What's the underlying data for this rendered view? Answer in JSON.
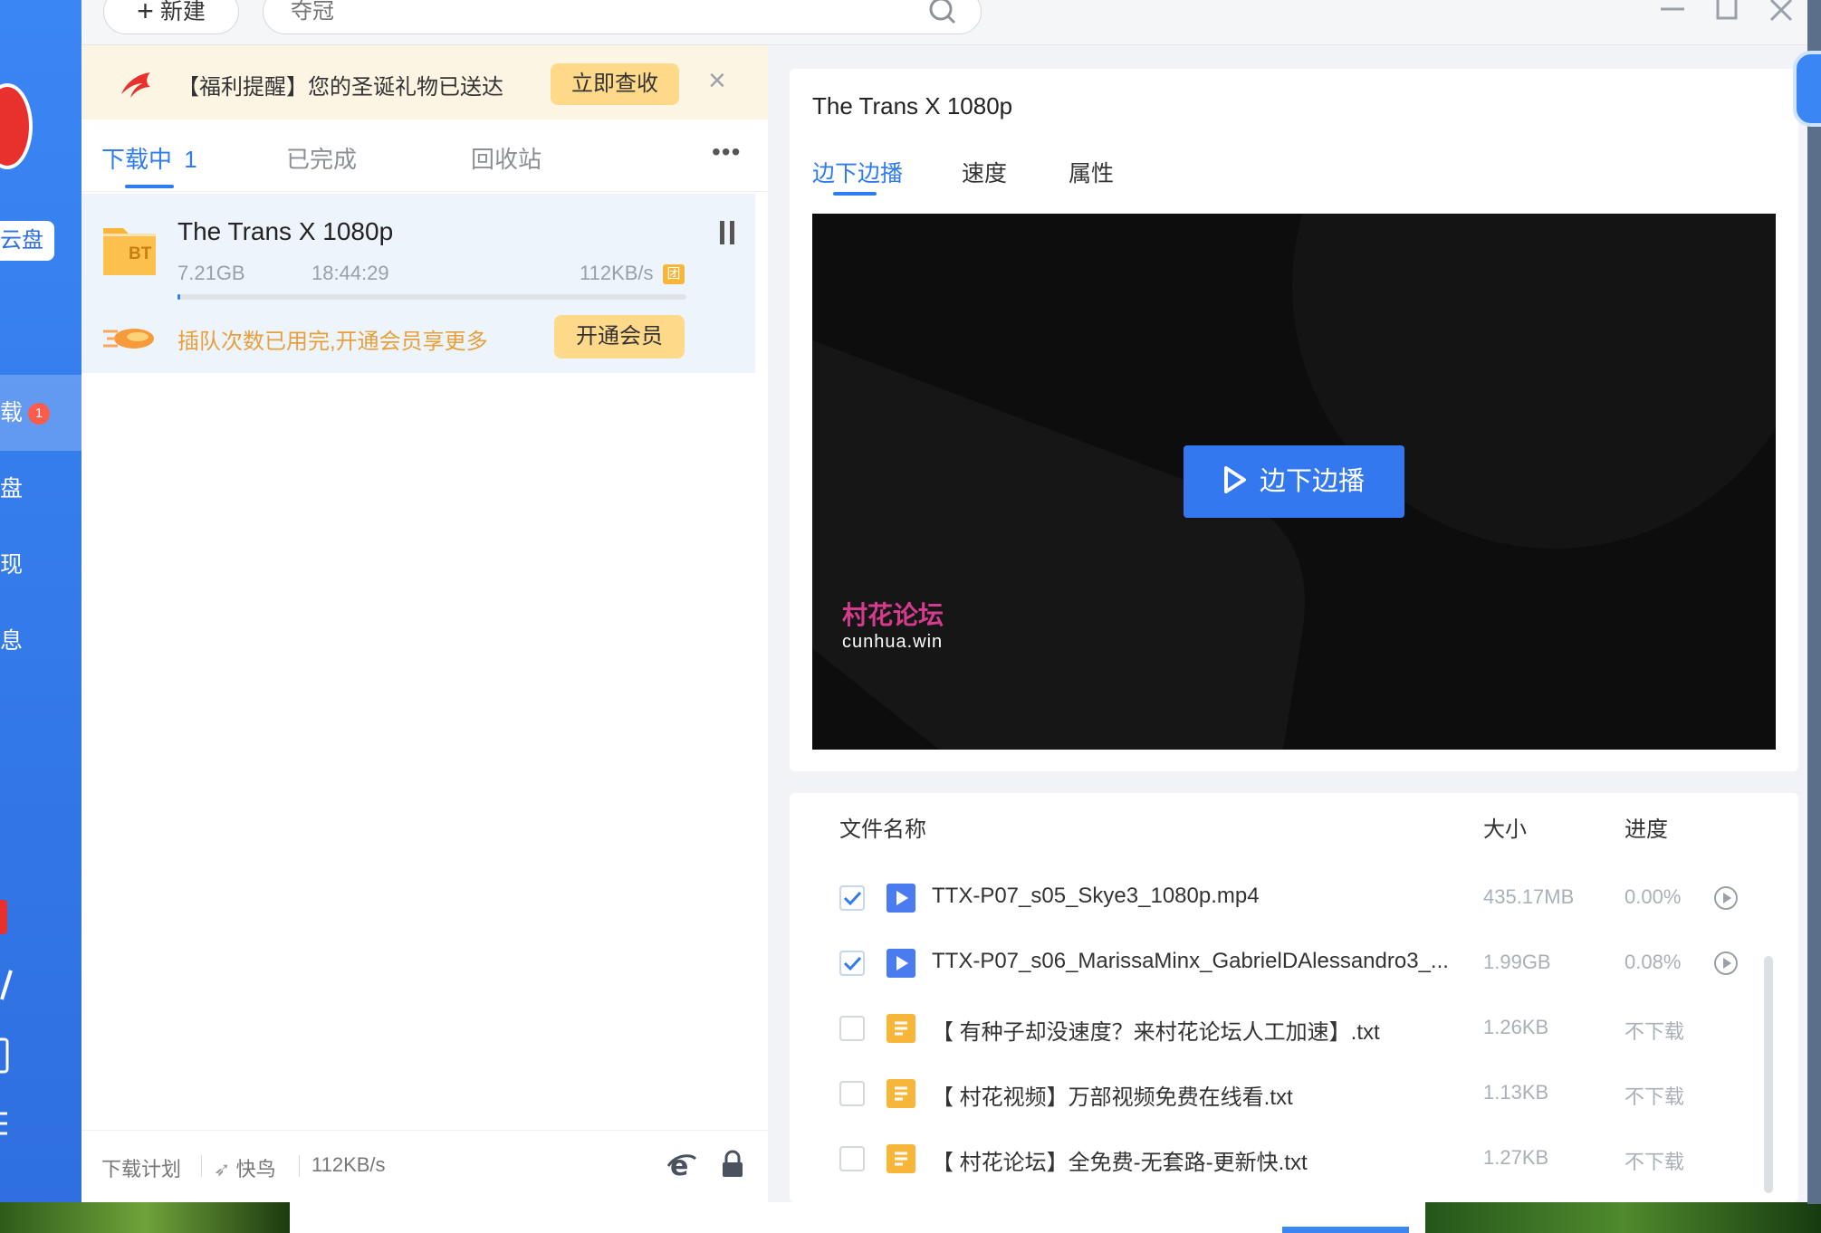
{
  "toolbar": {
    "new_label": "新建",
    "search_placeholder": "夺冠"
  },
  "sidebar": {
    "cloud_tab": "云盘",
    "items": [
      {
        "label": "下载",
        "badge": "1"
      },
      {
        "label": "云盘"
      },
      {
        "label": "发现"
      },
      {
        "label": "消息"
      }
    ]
  },
  "notice": {
    "text": "【福利提醒】您的圣诞礼物已送达",
    "button": "立即查收"
  },
  "tabs": [
    {
      "label": "下载中",
      "count": "1"
    },
    {
      "label": "已完成"
    },
    {
      "label": "回收站"
    }
  ],
  "download": {
    "name": "The Trans X 1080p",
    "size": "7.21GB",
    "time_left": "18:44:29",
    "speed": "112KB/s",
    "speed_badge": "团",
    "progress": 0.005,
    "promo_text": "插队次数已用完,开通会员享更多",
    "promo_button": "开通会员",
    "bt_label": "BT"
  },
  "footer": {
    "plan": "下载计划",
    "mode": "快鸟",
    "speed": "112KB/s"
  },
  "detail": {
    "title": "The Trans X 1080p",
    "tabs": [
      "边下边播",
      "速度",
      "属性"
    ],
    "play_button": "边下边播",
    "watermark_title": "村花论坛",
    "watermark_sub": "cunhua.win"
  },
  "files": {
    "headers": {
      "name": "文件名称",
      "size": "大小",
      "progress": "进度"
    },
    "rows": [
      {
        "name": "TTX-P07_s05_Skye3_1080p.mp4",
        "size": "435.17MB",
        "progress": "0.00%",
        "checked": true,
        "type": "video"
      },
      {
        "name": "TTX-P07_s06_MarissaMinx_GabrielDAlessandro3_...",
        "size": "1.99GB",
        "progress": "0.08%",
        "checked": true,
        "type": "video"
      },
      {
        "name": "【 有种子却没速度？来村花论坛人工加速】.txt",
        "size": "1.26KB",
        "progress": "不下载",
        "checked": false,
        "type": "text"
      },
      {
        "name": "【 村花视频】万部视频免费在线看.txt",
        "size": "1.13KB",
        "progress": "不下载",
        "checked": false,
        "type": "text"
      },
      {
        "name": "【 村花论坛】全免费-无套路-更新快.txt",
        "size": "1.27KB",
        "progress": "不下载",
        "checked": false,
        "type": "text"
      }
    ]
  },
  "colors": {
    "accent": "#2f7bf2",
    "sidebar": "#3a86f4",
    "video_icon": "#4a7cf0",
    "text_icon": "#f7b53a"
  }
}
